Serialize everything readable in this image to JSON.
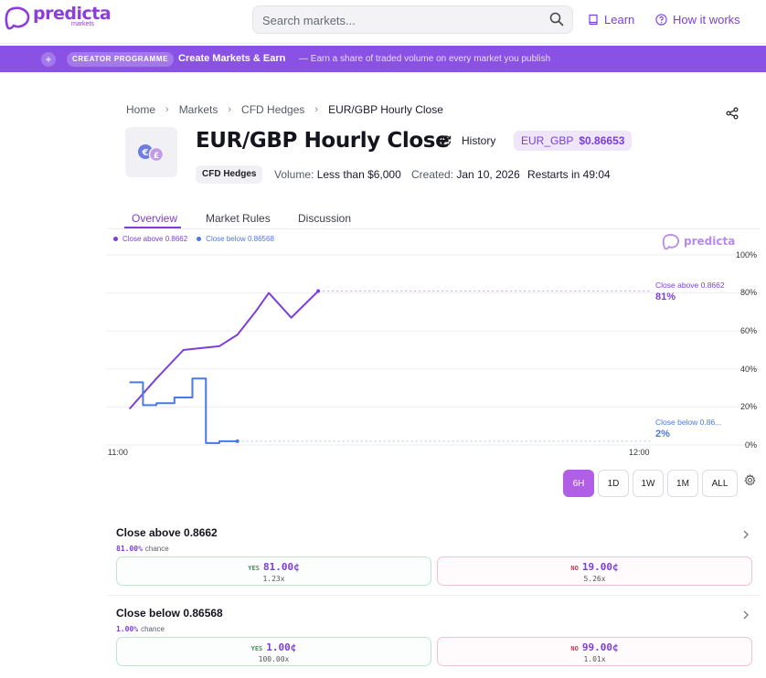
{
  "brand": {
    "name": "predicta",
    "sub": "markets",
    "color": "#8b3dde"
  },
  "search": {
    "placeholder": "Search markets..."
  },
  "nav": {
    "learn": "Learn",
    "how_it_works": "How it works"
  },
  "banner": {
    "pill": "CREATOR PROGRAMME",
    "headline": "Create Markets & Earn",
    "sub": "— Earn a share of traded volume on every market you publish",
    "color": "#8a52e4"
  },
  "breadcrumb": [
    "Home",
    "Markets",
    "CFD Hedges",
    "EUR/GBP Hourly Close"
  ],
  "market": {
    "title": "EUR/GBP Hourly Close",
    "history_label": "History",
    "ticker_symbol": "EUR_GBP",
    "ticker_price": "$0.86653",
    "tag": "CFD Hedges",
    "volume_label": "Volume:",
    "volume_value": "Less than $6,000",
    "created_label": "Created:",
    "created_value": "Jan 10, 2026",
    "restarts": "Restarts in 49:04"
  },
  "tabs": [
    "Overview",
    "Market Rules",
    "Discussion"
  ],
  "chart_data": {
    "type": "line",
    "title": "",
    "xlabel": "",
    "ylabel": "",
    "ylim": [
      0,
      100
    ],
    "y_ticks": [
      "100%",
      "80%",
      "60%",
      "40%",
      "20%",
      "0%"
    ],
    "x_ticks": [
      "11:00",
      "12:00"
    ],
    "x_unit": "minutes after 11:00",
    "xlim": [
      0,
      60
    ],
    "watermark": "predicta",
    "series": [
      {
        "name": "Close above 0.8662",
        "color": "#7c3fd9",
        "end_label": "Close above 0.8662",
        "end_value": "81%",
        "points": [
          [
            2,
            19
          ],
          [
            5,
            35
          ],
          [
            8,
            50
          ],
          [
            10,
            51
          ],
          [
            12,
            52
          ],
          [
            14,
            58
          ],
          [
            16,
            70
          ],
          [
            17.5,
            80
          ],
          [
            20,
            67
          ],
          [
            23,
            81
          ]
        ]
      },
      {
        "name": "Close below 0.86568",
        "color": "#4a78e8",
        "end_label": "Close below 0.86...",
        "end_value": "2%",
        "step": true,
        "points": [
          [
            2,
            33
          ],
          [
            3.5,
            33
          ],
          [
            3.5,
            21
          ],
          [
            5,
            21
          ],
          [
            5,
            22
          ],
          [
            7,
            22
          ],
          [
            7,
            25
          ],
          [
            9,
            25
          ],
          [
            9,
            35
          ],
          [
            10.5,
            35
          ],
          [
            10.5,
            1
          ],
          [
            12,
            1
          ],
          [
            12,
            2
          ],
          [
            14,
            2
          ]
        ]
      }
    ]
  },
  "ranges": [
    "6H",
    "1D",
    "1W",
    "1M",
    "ALL"
  ],
  "outcomes": [
    {
      "name": "Close above 0.8662",
      "chance_pct": "81.00%",
      "chance_word": "chance",
      "yes_label": "YES",
      "yes_price": "81.00¢",
      "yes_mult": "1.23x",
      "no_label": "NO",
      "no_price": "19.00¢",
      "no_mult": "5.26x"
    },
    {
      "name": "Close below 0.86568",
      "chance_pct": "1.00%",
      "chance_word": "chance",
      "yes_label": "YES",
      "yes_price": "1.00¢",
      "yes_mult": "100.00x",
      "no_label": "NO",
      "no_price": "99.00¢",
      "no_mult": "1.01x"
    }
  ],
  "icons": {
    "logo": "predicta-logo-icon",
    "search": "search-icon",
    "learn": "book-icon",
    "how": "question-circle-icon",
    "share": "share-icon",
    "history": "refresh-icon",
    "settings": "gear-icon",
    "chevron": "chevron-right-icon"
  }
}
